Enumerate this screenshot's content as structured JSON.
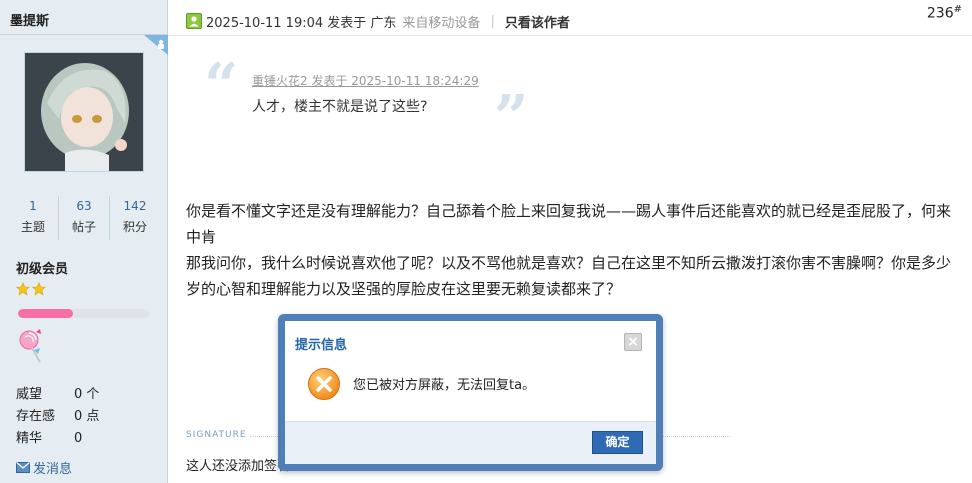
{
  "author": {
    "name": "墨提斯",
    "stats": [
      {
        "value": "1",
        "label": "主题"
      },
      {
        "value": "63",
        "label": "帖子"
      },
      {
        "value": "142",
        "label": "积分"
      }
    ],
    "group": "初级会员",
    "stars": 2,
    "level_progress": 0.42,
    "credits": [
      {
        "label": "威望",
        "value": "0 个"
      },
      {
        "label": "存在感",
        "value": "0 点"
      },
      {
        "label": "精华",
        "value": "0"
      }
    ],
    "send_message": "发消息"
  },
  "post": {
    "time": "2025-10-11 19:04 发表于 广东",
    "from": "来自移动设备",
    "only_author": "只看该作者",
    "floor_number": "236",
    "floor_suffix": "#",
    "quote": {
      "meta": "重锤火花2 发表于 2025-10-11 18:24:29",
      "text": "人才，楼主不就是说了这些?"
    },
    "body_line1": "你是看不懂文字还是没有理解能力？自己舔着个脸上来回复我说——踢人事件后还能喜欢的就已经是歪屁股了，何来中肯",
    "body_line2": "那我问你，我什么时候说喜欢他了呢？以及不骂他就是喜欢？自己在这里不知所云撒泼打滚你害不害臊啊？你是多少岁的心智和理解能力以及坚强的厚脸皮在这里要无赖复读都来了？",
    "signature_label": "SIGNATURE",
    "signature_text": "这人还没添加签名"
  },
  "dialog": {
    "title": "提示信息",
    "close_glyph": "×",
    "message": "您已被对方屏蔽，无法回复ta。",
    "ok_label": "确定"
  },
  "colors": {
    "sidebar_bg": "#e5edf2",
    "link": "#336699",
    "dialog_border": "#4f7fb8",
    "dialog_title": "#2366a8",
    "level_fill": "#f76fa7",
    "error_icon": "#f08a1c"
  }
}
